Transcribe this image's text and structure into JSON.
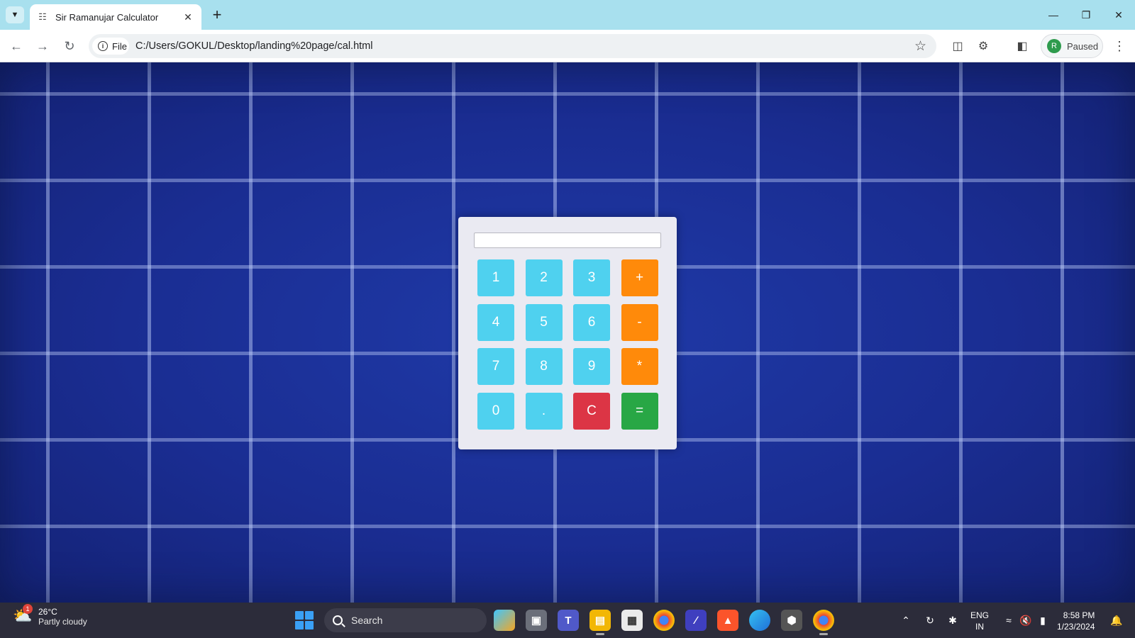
{
  "browser": {
    "tab": {
      "title": "Sir Ramanujar Calculator",
      "favicon": "page-icon"
    },
    "address": {
      "chip_label": "File",
      "url": "C:/Users/GOKUL/Desktop/landing%20page/cal.html"
    },
    "profile": {
      "initial": "R",
      "status": "Paused"
    }
  },
  "calculator": {
    "display_value": "",
    "keys": [
      {
        "label": "1",
        "kind": "num"
      },
      {
        "label": "2",
        "kind": "num"
      },
      {
        "label": "3",
        "kind": "num"
      },
      {
        "label": "+",
        "kind": "op"
      },
      {
        "label": "4",
        "kind": "num"
      },
      {
        "label": "5",
        "kind": "num"
      },
      {
        "label": "6",
        "kind": "num"
      },
      {
        "label": "-",
        "kind": "op"
      },
      {
        "label": "7",
        "kind": "num"
      },
      {
        "label": "8",
        "kind": "num"
      },
      {
        "label": "9",
        "kind": "num"
      },
      {
        "label": "*",
        "kind": "op"
      },
      {
        "label": "0",
        "kind": "num"
      },
      {
        "label": ".",
        "kind": "num"
      },
      {
        "label": "C",
        "kind": "clear"
      },
      {
        "label": "=",
        "kind": "equals"
      }
    ],
    "colors": {
      "num": "#4fd1ef",
      "op": "#ff8a0a",
      "clear": "#dc3545",
      "equals": "#28a745"
    }
  },
  "taskbar": {
    "weather": {
      "temp": "26°C",
      "condition": "Partly cloudy",
      "badge": "1"
    },
    "search_label": "Search",
    "lang": {
      "line1": "ENG",
      "line2": "IN"
    },
    "clock": {
      "time": "8:58 PM",
      "date": "1/23/2024"
    }
  }
}
